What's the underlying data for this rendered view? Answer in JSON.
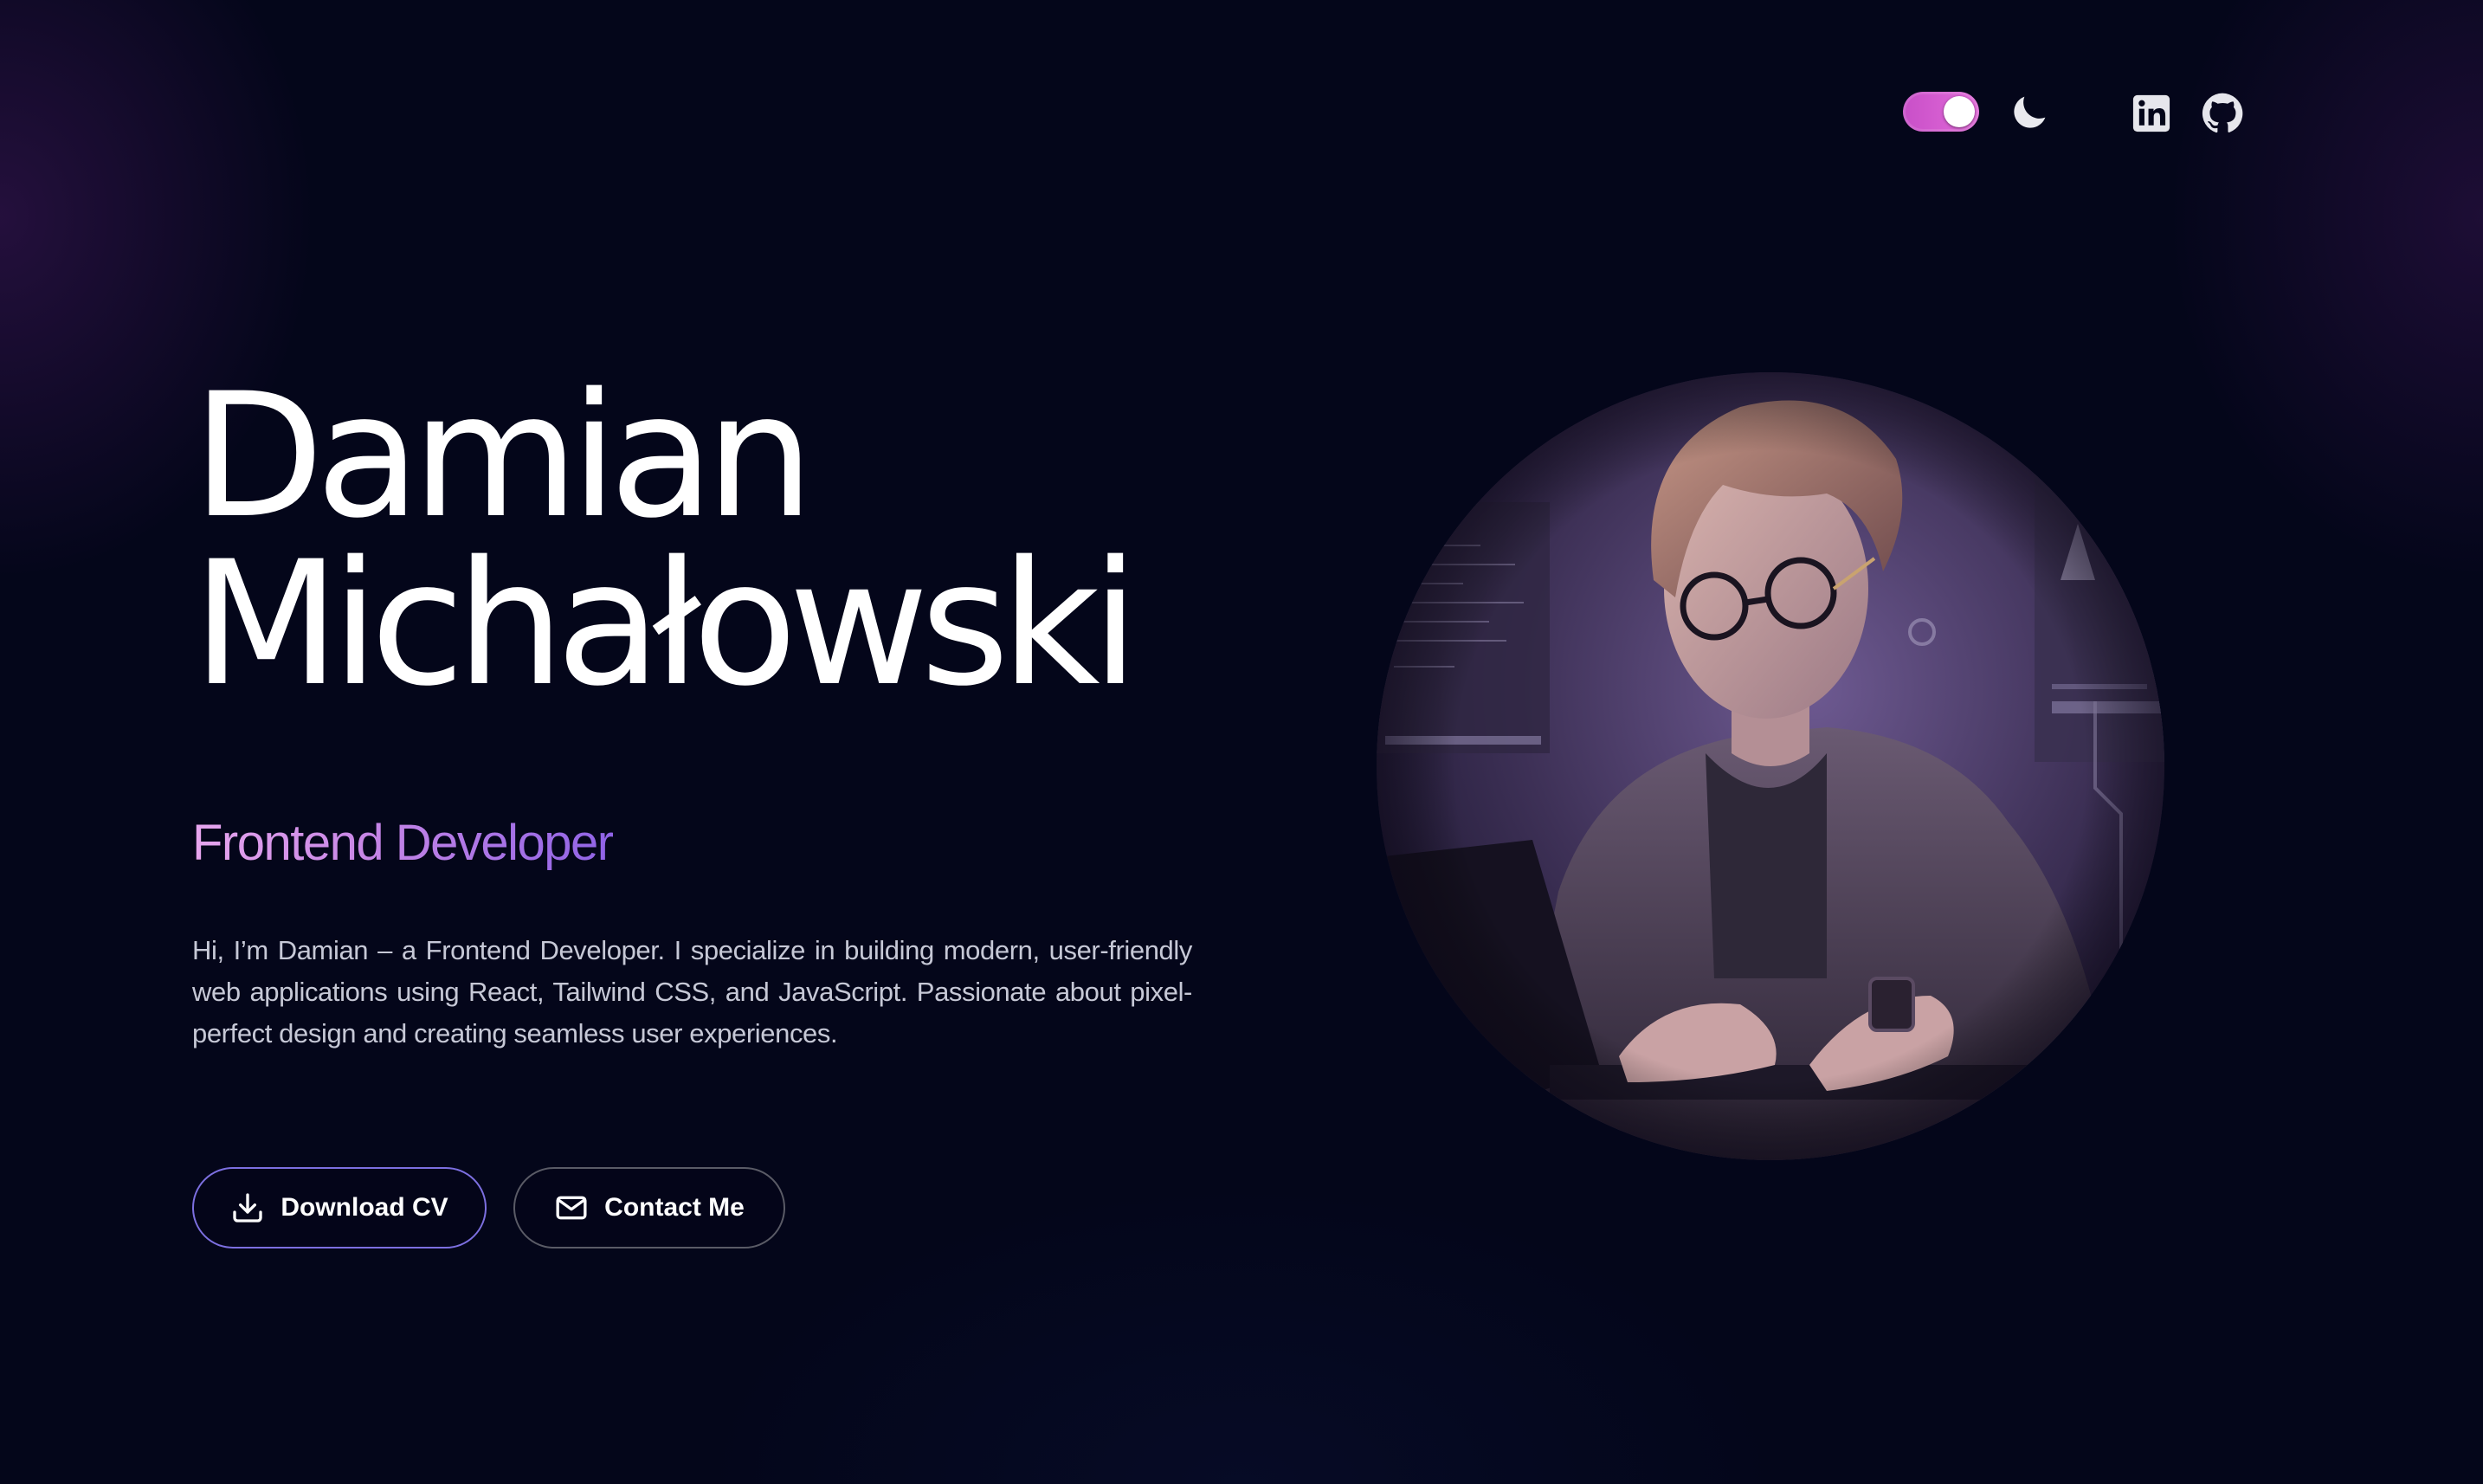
{
  "header": {
    "theme_toggle": {
      "state": "on",
      "accent": "#d65ed2"
    },
    "icons": [
      "moon-icon",
      "linkedin-icon",
      "github-icon"
    ]
  },
  "hero": {
    "name_first": "Damian",
    "name_last": "Michałowski",
    "role": "Frontend Developer",
    "bio": "Hi, I’m Damian – a Frontend Developer. I specialize in building modern, user-friendly web applications using React, Tailwind CSS, and JavaScript. Passionate about pixel-perfect design and creating seamless user experiences.",
    "buttons": {
      "download_cv": "Download CV",
      "contact_me": "Contact Me"
    }
  },
  "colors": {
    "background": "#04061a",
    "role_gradient_start": "#e7a6ee",
    "role_gradient_end": "#8f63e6",
    "cv_button_border": "#7c6fe0"
  }
}
